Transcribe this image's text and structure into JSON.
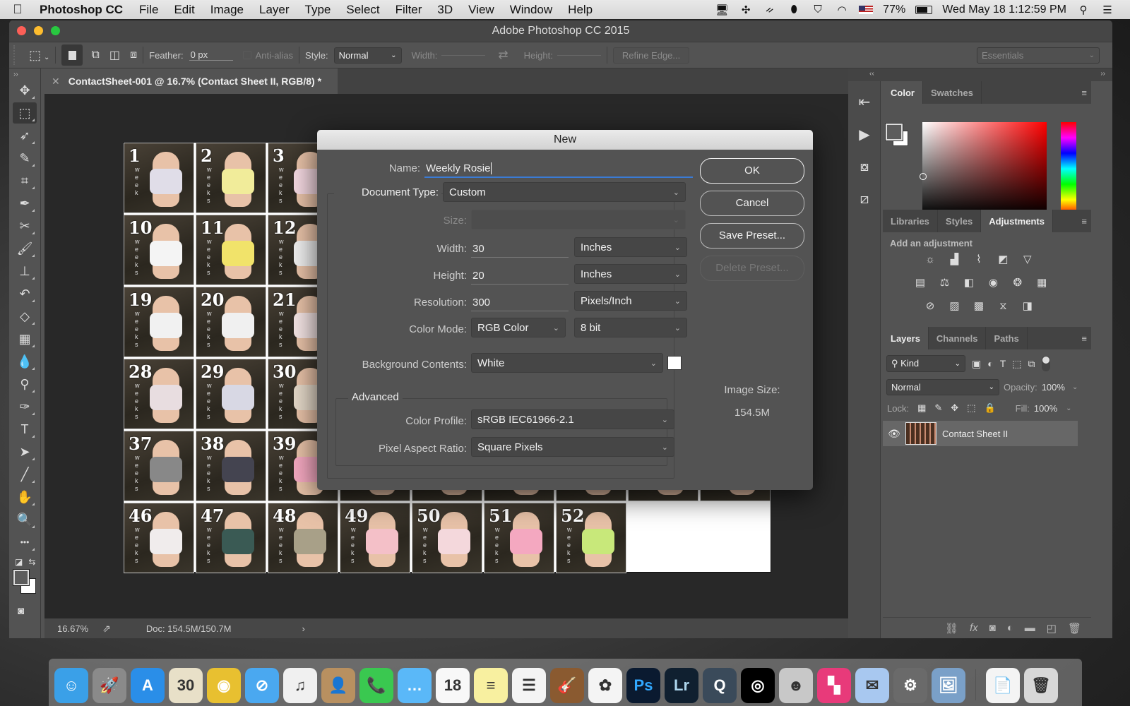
{
  "menubar": {
    "app_name": "Photoshop CC",
    "items": [
      "File",
      "Edit",
      "Image",
      "Layer",
      "Type",
      "Select",
      "Filter",
      "3D",
      "View",
      "Window",
      "Help"
    ],
    "battery": "77%",
    "clock": "Wed May 18  1:12:59 PM"
  },
  "window": {
    "title": "Adobe Photoshop CC 2015"
  },
  "options_bar": {
    "feather_label": "Feather:",
    "feather_value": "0 px",
    "anti_alias_label": "Anti-alias",
    "style_label": "Style:",
    "style_value": "Normal",
    "width_label": "Width:",
    "height_label": "Height:",
    "refine_edge_label": "Refine Edge...",
    "workspace_value": "Essentials"
  },
  "document": {
    "tab_title": "ContactSheet-001 @ 16.7% (Contact Sheet II, RGB/8) *",
    "zoom": "16.67%",
    "doc_size": "Doc: 154.5M/150.7M",
    "thumbnails": [
      {
        "num": "1",
        "label": "week",
        "cloth": "#e0dde8"
      },
      {
        "num": "2",
        "label": "weeks",
        "cloth": "#f1ec9a"
      },
      {
        "num": "3",
        "label": "weeks",
        "cloth": "#f3d7e0"
      },
      {
        "num": "10",
        "label": "weeks",
        "cloth": "#f4f4f4"
      },
      {
        "num": "11",
        "label": "weeks",
        "cloth": "#f1e36a"
      },
      {
        "num": "12",
        "label": "weeks",
        "cloth": "#efefef"
      },
      {
        "num": "19",
        "label": "weeks",
        "cloth": "#f1f1f1"
      },
      {
        "num": "20",
        "label": "weeks",
        "cloth": "#f0f0f0"
      },
      {
        "num": "21",
        "label": "weeks",
        "cloth": "#f4e4e4"
      },
      {
        "num": "28",
        "label": "weeks",
        "cloth": "#e8dde0"
      },
      {
        "num": "29",
        "label": "weeks",
        "cloth": "#d8d8e4"
      },
      {
        "num": "30",
        "label": "weeks",
        "cloth": "#e4d8c8"
      },
      {
        "num": "37",
        "label": "weeks",
        "cloth": "#888888"
      },
      {
        "num": "38",
        "label": "weeks",
        "cloth": "#444450"
      },
      {
        "num": "39",
        "label": "weeks",
        "cloth": "#f4a8c0"
      },
      {
        "num": "46",
        "label": "weeks",
        "cloth": "#f0ecec"
      },
      {
        "num": "47",
        "label": "weeks",
        "cloth": "#3a5a54"
      },
      {
        "num": "48",
        "label": "weeks",
        "cloth": "#a8a088"
      },
      {
        "num": "49",
        "label": "weeks",
        "cloth": "#f4c0c8"
      },
      {
        "num": "50",
        "label": "weeks",
        "cloth": "#f4d8dc"
      },
      {
        "num": "51",
        "label": "weeks",
        "cloth": "#f4a8c0"
      },
      {
        "num": "52",
        "label": "weeks",
        "cloth": "#c8e87a"
      }
    ]
  },
  "tools": [
    {
      "name": "move-tool",
      "glyph": "✥"
    },
    {
      "name": "rectangular-marquee-tool",
      "glyph": "⬚",
      "active": true
    },
    {
      "name": "lasso-tool",
      "glyph": "➶"
    },
    {
      "name": "quick-selection-tool",
      "glyph": "✎"
    },
    {
      "name": "crop-tool",
      "glyph": "⌗"
    },
    {
      "name": "eyedropper-tool",
      "glyph": "✒"
    },
    {
      "name": "healing-brush-tool",
      "glyph": "✂"
    },
    {
      "name": "brush-tool",
      "glyph": "🖌"
    },
    {
      "name": "clone-stamp-tool",
      "glyph": "⊥"
    },
    {
      "name": "history-brush-tool",
      "glyph": "↶"
    },
    {
      "name": "eraser-tool",
      "glyph": "◇"
    },
    {
      "name": "gradient-tool",
      "glyph": "▦"
    },
    {
      "name": "blur-tool",
      "glyph": "💧"
    },
    {
      "name": "dodge-tool",
      "glyph": "⚲"
    },
    {
      "name": "pen-tool",
      "glyph": "✑"
    },
    {
      "name": "type-tool",
      "glyph": "T"
    },
    {
      "name": "path-selection-tool",
      "glyph": "➤"
    },
    {
      "name": "line-tool",
      "glyph": "╱"
    },
    {
      "name": "hand-tool",
      "glyph": "✋"
    },
    {
      "name": "zoom-tool",
      "glyph": "🔍"
    },
    {
      "name": "edit-toolbar",
      "glyph": "•••"
    }
  ],
  "panels": {
    "color_tabs": [
      "Color",
      "Swatches"
    ],
    "adjust_tabs": [
      "Libraries",
      "Styles",
      "Adjustments"
    ],
    "add_adjustment": "Add an adjustment",
    "layers_tabs": [
      "Layers",
      "Channels",
      "Paths"
    ],
    "filter_kind": "Kind",
    "blend_mode": "Normal",
    "opacity_label": "Opacity:",
    "opacity_value": "100%",
    "lock_label": "Lock:",
    "fill_label": "Fill:",
    "fill_value": "100%",
    "layer_name": "Contact Sheet II"
  },
  "dialog": {
    "title": "New",
    "name_label": "Name:",
    "name_value": "Weekly Rosie",
    "doc_type_label": "Document Type:",
    "doc_type_value": "Custom",
    "size_label": "Size:",
    "width_label": "Width:",
    "width_value": "30",
    "width_unit": "Inches",
    "height_label": "Height:",
    "height_value": "20",
    "height_unit": "Inches",
    "resolution_label": "Resolution:",
    "resolution_value": "300",
    "resolution_unit": "Pixels/Inch",
    "color_mode_label": "Color Mode:",
    "color_mode_value": "RGB Color",
    "bit_depth_value": "8 bit",
    "background_label": "Background Contents:",
    "background_value": "White",
    "advanced_label": "Advanced",
    "color_profile_label": "Color Profile:",
    "color_profile_value": "sRGB IEC61966-2.1",
    "pixel_aspect_label": "Pixel Aspect Ratio:",
    "pixel_aspect_value": "Square Pixels",
    "ok_label": "OK",
    "cancel_label": "Cancel",
    "save_preset_label": "Save Preset...",
    "delete_preset_label": "Delete Preset...",
    "image_size_label": "Image Size:",
    "image_size_value": "154.5M"
  },
  "dock": [
    {
      "name": "finder",
      "bg": "#3aa0e8",
      "glyph": "☺"
    },
    {
      "name": "launchpad",
      "bg": "#8a8a8a",
      "glyph": "🚀"
    },
    {
      "name": "app-store",
      "bg": "#2a8ee8",
      "glyph": "A"
    },
    {
      "name": "dashboard",
      "bg": "#e8e0c8",
      "glyph": "30"
    },
    {
      "name": "chrome",
      "bg": "#e8c030",
      "glyph": "◉"
    },
    {
      "name": "safari",
      "bg": "#4aa8f0",
      "glyph": "⊘"
    },
    {
      "name": "itunes",
      "bg": "#f0f0f0",
      "glyph": "♫"
    },
    {
      "name": "contacts",
      "bg": "#b89060",
      "glyph": "👤"
    },
    {
      "name": "facetime",
      "bg": "#3ac850",
      "glyph": "📞"
    },
    {
      "name": "messages",
      "bg": "#5ab8f8",
      "glyph": "…"
    },
    {
      "name": "calendar",
      "bg": "#f8f8f8",
      "glyph": "18"
    },
    {
      "name": "notes",
      "bg": "#f8f0a0",
      "glyph": "≡"
    },
    {
      "name": "reminders",
      "bg": "#f4f4f4",
      "glyph": "☰"
    },
    {
      "name": "garageband",
      "bg": "#8a5a30",
      "glyph": "🎸"
    },
    {
      "name": "photos",
      "bg": "#f4f4f4",
      "glyph": "✿"
    },
    {
      "name": "photoshop",
      "bg": "#0a1a30",
      "glyph": "Ps"
    },
    {
      "name": "lightroom",
      "bg": "#102030",
      "glyph": "Lr"
    },
    {
      "name": "quicktime",
      "bg": "#3a4a5a",
      "glyph": "Q"
    },
    {
      "name": "cortana-app",
      "bg": "#000000",
      "glyph": "◎"
    },
    {
      "name": "photo-booth",
      "bg": "#c8c8c8",
      "glyph": "☻"
    },
    {
      "name": "color-app",
      "bg": "#e83a7a",
      "glyph": "▚"
    },
    {
      "name": "mail",
      "bg": "#a8c8f0",
      "glyph": "✉"
    },
    {
      "name": "system-preferences",
      "bg": "#6a6a6a",
      "glyph": "⚙"
    },
    {
      "name": "preview",
      "bg": "#7aa0c8",
      "glyph": "🖼"
    },
    {
      "name": "document",
      "bg": "#f4f4f4",
      "glyph": "📄"
    },
    {
      "name": "trash",
      "bg": "#d8d8d8",
      "glyph": "🗑"
    }
  ]
}
